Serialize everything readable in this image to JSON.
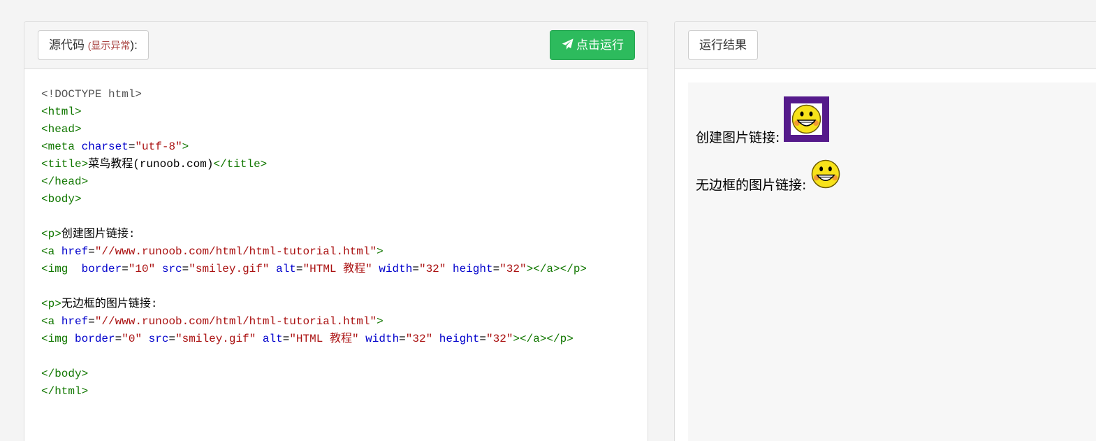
{
  "source_panel": {
    "label": "源代码",
    "warning_open": "(",
    "warning_link": "显示异常",
    "warning_close": "):",
    "run_label": "点击运行"
  },
  "result_panel": {
    "label": "运行结果"
  },
  "code": {
    "doctype": "<!DOCTYPE html>",
    "html_open": "<html>",
    "head_open": "<head>",
    "meta_tag": "<meta",
    "meta_attr": "charset",
    "meta_val": "\"utf-8\"",
    "title_open": "<title>",
    "title_text": "菜鸟教程(runoob.com)",
    "title_close": "</title>",
    "head_close": "</head>",
    "body_open": "<body>",
    "p1_open": "<p>",
    "p1_text": "创建图片链接:",
    "a_open": "<a",
    "href_attr": "href",
    "href_val": "\"//www.runoob.com/html/html-tutorial.html\"",
    "img_tag": "<img",
    "border_attr": "border",
    "border1_val": "\"10\"",
    "src_attr": "src",
    "src_val": "\"smiley.gif\"",
    "alt_attr": "alt",
    "alt_val": "\"HTML 教程\"",
    "width_attr": "width",
    "width_val": "\"32\"",
    "height_attr": "height",
    "height_val": "\"32\"",
    "close1": "></a></p>",
    "p2_open": "<p>",
    "p2_text": "无边框的图片链接:",
    "border2_val": "\"0\"",
    "close2": "></a></p>",
    "body_close": "</body>",
    "html_close": "</html>"
  },
  "result": {
    "p1_text": "创建图片链接:",
    "p2_text": "无边框的图片链接:",
    "img_alt": "HTML 教程"
  },
  "colors": {
    "run_button": "#2dbb5d",
    "tag": "#117700",
    "attr": "#0000cc",
    "string": "#aa1111",
    "link_border": "#551a8b"
  }
}
